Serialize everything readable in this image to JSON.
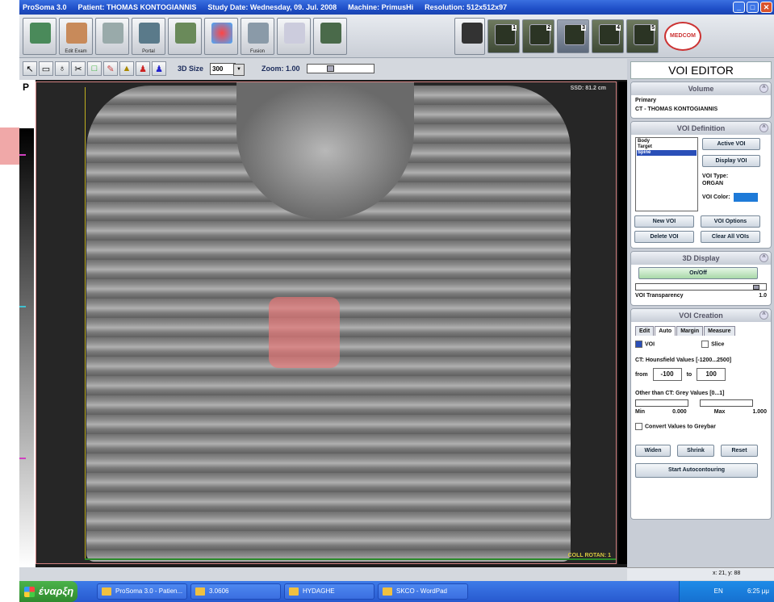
{
  "titlebar": {
    "app": "ProSoma 3.0",
    "patient": "Patient:  THOMAS KONTOGIANNIS",
    "study": "Study Date:  Wednesday, 09. Jul. 2008",
    "machine": "Machine:  PrimusHi",
    "resolution": "Resolution:  512x512x97"
  },
  "toolbar": {
    "edit_exam": "Edit Exam",
    "portal": "Portal",
    "fusion": "Fusion",
    "layouts": [
      "1",
      "2",
      "3",
      "4",
      "5"
    ]
  },
  "brand": "MEDCOM",
  "toolbar2": {
    "size_label": "3D Size",
    "size_value": "300",
    "zoom_label": "Zoom:  1.00"
  },
  "viewer": {
    "orientation": "P",
    "top_right": "SSD: 81.2 cm",
    "bottom_right": "COLL ROTAN: 1"
  },
  "panel": {
    "title": "VOI EDITOR",
    "volume": {
      "header": "Volume",
      "line1": "Primary",
      "line2": "CT - THOMAS KONTOGIANNIS"
    },
    "voi_def": {
      "header": "VOI Definition",
      "items": [
        "Body",
        "Target",
        "Spine"
      ],
      "active_btn": "Active VOI",
      "display_btn": "Display VOI",
      "type_label": "VOI Type:",
      "type_value": "ORGAN",
      "color_label": "VOI Color:",
      "color": "#1e7ad8",
      "new_btn": "New VOI",
      "options_btn": "VOI Options",
      "delete_btn": "Delete VOI",
      "clear_btn": "Clear All VOIs"
    },
    "display3d": {
      "header": "3D Display",
      "onoff": "On/Off",
      "transp_label": "VOI Transparency",
      "transp_value": "1.0"
    },
    "creation": {
      "header": "VOI Creation",
      "tabs": [
        "Edit",
        "Auto",
        "Margin",
        "Measure"
      ],
      "voi_label": "VOI",
      "slice_label": "Slice",
      "ct_label": "CT:  Hounsfield Values [-1200...2500]",
      "from_label": "from",
      "from_value": "-100",
      "to_label": "to",
      "to_value": "100",
      "other_label": "Other than CT:  Grey Values [0...1]",
      "min_label": "Min",
      "min_value": "0.000",
      "max_label": "Max",
      "max_value": "1.000",
      "convert_label": "Convert Values to Greybar",
      "widen_btn": "Widen",
      "shrink_btn": "Shrink",
      "reset_btn": "Reset",
      "start_btn": "Start Autocontouring"
    }
  },
  "status": "x: 21, y: 88",
  "taskbar": {
    "start": "έναρξη",
    "tasks": [
      "ProSoma 3.0 - Patien...",
      "3.0606",
      "HYDAGHE",
      "SKCO - WordPad"
    ],
    "tray_time": "6:25 μμ",
    "tray_lang": "EN"
  }
}
